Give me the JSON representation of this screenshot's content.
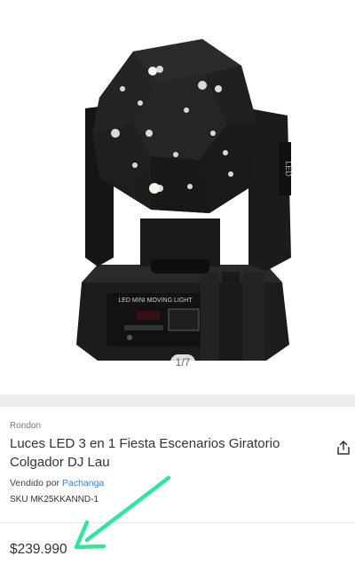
{
  "gallery": {
    "counter": "1/7",
    "image": "LED moving head light product photo",
    "product_label": "LED MINI MOVING LIGHT",
    "side_label": "LED"
  },
  "product": {
    "brand": "Rondon",
    "title": "Luces LED 3 en 1 Fiesta Escenarios Giratorio Colgador DJ Lau",
    "sold_by_prefix": "Vendido por",
    "seller": "Pachanga",
    "sku": "SKU MK25KKANND-1",
    "price": "$239.990"
  },
  "annotation": {
    "arrow_color": "#2ee89a"
  },
  "icons": {
    "share": "share-icon"
  }
}
